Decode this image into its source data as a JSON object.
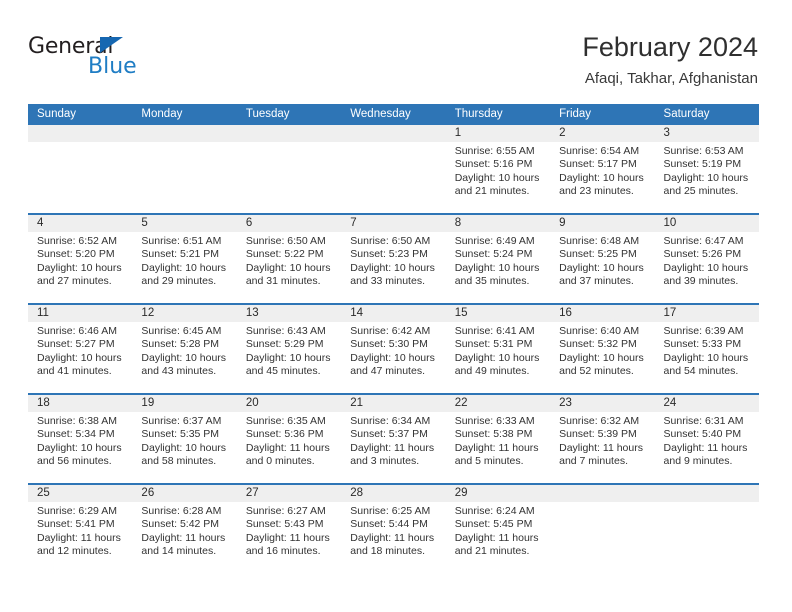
{
  "brand": {
    "name_part1": "General",
    "name_part2": "Blue",
    "triangle_icon": "triangle-icon",
    "accent_color": "#1f7dc4"
  },
  "header": {
    "title": "February 2024",
    "subtitle": "Afaqi, Takhar, Afghanistan"
  },
  "theme": {
    "header_blue": "#2e75b6",
    "daynum_gray": "#efefef",
    "text": "#333333"
  },
  "calendar": {
    "weekday_headers": [
      "Sunday",
      "Monday",
      "Tuesday",
      "Wednesday",
      "Thursday",
      "Friday",
      "Saturday"
    ],
    "weeks": [
      [
        {
          "day": "",
          "lines": []
        },
        {
          "day": "",
          "lines": []
        },
        {
          "day": "",
          "lines": []
        },
        {
          "day": "",
          "lines": []
        },
        {
          "day": "1",
          "lines": [
            "Sunrise: 6:55 AM",
            "Sunset: 5:16 PM",
            "Daylight: 10 hours",
            "and 21 minutes."
          ]
        },
        {
          "day": "2",
          "lines": [
            "Sunrise: 6:54 AM",
            "Sunset: 5:17 PM",
            "Daylight: 10 hours",
            "and 23 minutes."
          ]
        },
        {
          "day": "3",
          "lines": [
            "Sunrise: 6:53 AM",
            "Sunset: 5:19 PM",
            "Daylight: 10 hours",
            "and 25 minutes."
          ]
        }
      ],
      [
        {
          "day": "4",
          "lines": [
            "Sunrise: 6:52 AM",
            "Sunset: 5:20 PM",
            "Daylight: 10 hours",
            "and 27 minutes."
          ]
        },
        {
          "day": "5",
          "lines": [
            "Sunrise: 6:51 AM",
            "Sunset: 5:21 PM",
            "Daylight: 10 hours",
            "and 29 minutes."
          ]
        },
        {
          "day": "6",
          "lines": [
            "Sunrise: 6:50 AM",
            "Sunset: 5:22 PM",
            "Daylight: 10 hours",
            "and 31 minutes."
          ]
        },
        {
          "day": "7",
          "lines": [
            "Sunrise: 6:50 AM",
            "Sunset: 5:23 PM",
            "Daylight: 10 hours",
            "and 33 minutes."
          ]
        },
        {
          "day": "8",
          "lines": [
            "Sunrise: 6:49 AM",
            "Sunset: 5:24 PM",
            "Daylight: 10 hours",
            "and 35 minutes."
          ]
        },
        {
          "day": "9",
          "lines": [
            "Sunrise: 6:48 AM",
            "Sunset: 5:25 PM",
            "Daylight: 10 hours",
            "and 37 minutes."
          ]
        },
        {
          "day": "10",
          "lines": [
            "Sunrise: 6:47 AM",
            "Sunset: 5:26 PM",
            "Daylight: 10 hours",
            "and 39 minutes."
          ]
        }
      ],
      [
        {
          "day": "11",
          "lines": [
            "Sunrise: 6:46 AM",
            "Sunset: 5:27 PM",
            "Daylight: 10 hours",
            "and 41 minutes."
          ]
        },
        {
          "day": "12",
          "lines": [
            "Sunrise: 6:45 AM",
            "Sunset: 5:28 PM",
            "Daylight: 10 hours",
            "and 43 minutes."
          ]
        },
        {
          "day": "13",
          "lines": [
            "Sunrise: 6:43 AM",
            "Sunset: 5:29 PM",
            "Daylight: 10 hours",
            "and 45 minutes."
          ]
        },
        {
          "day": "14",
          "lines": [
            "Sunrise: 6:42 AM",
            "Sunset: 5:30 PM",
            "Daylight: 10 hours",
            "and 47 minutes."
          ]
        },
        {
          "day": "15",
          "lines": [
            "Sunrise: 6:41 AM",
            "Sunset: 5:31 PM",
            "Daylight: 10 hours",
            "and 49 minutes."
          ]
        },
        {
          "day": "16",
          "lines": [
            "Sunrise: 6:40 AM",
            "Sunset: 5:32 PM",
            "Daylight: 10 hours",
            "and 52 minutes."
          ]
        },
        {
          "day": "17",
          "lines": [
            "Sunrise: 6:39 AM",
            "Sunset: 5:33 PM",
            "Daylight: 10 hours",
            "and 54 minutes."
          ]
        }
      ],
      [
        {
          "day": "18",
          "lines": [
            "Sunrise: 6:38 AM",
            "Sunset: 5:34 PM",
            "Daylight: 10 hours",
            "and 56 minutes."
          ]
        },
        {
          "day": "19",
          "lines": [
            "Sunrise: 6:37 AM",
            "Sunset: 5:35 PM",
            "Daylight: 10 hours",
            "and 58 minutes."
          ]
        },
        {
          "day": "20",
          "lines": [
            "Sunrise: 6:35 AM",
            "Sunset: 5:36 PM",
            "Daylight: 11 hours",
            "and 0 minutes."
          ]
        },
        {
          "day": "21",
          "lines": [
            "Sunrise: 6:34 AM",
            "Sunset: 5:37 PM",
            "Daylight: 11 hours",
            "and 3 minutes."
          ]
        },
        {
          "day": "22",
          "lines": [
            "Sunrise: 6:33 AM",
            "Sunset: 5:38 PM",
            "Daylight: 11 hours",
            "and 5 minutes."
          ]
        },
        {
          "day": "23",
          "lines": [
            "Sunrise: 6:32 AM",
            "Sunset: 5:39 PM",
            "Daylight: 11 hours",
            "and 7 minutes."
          ]
        },
        {
          "day": "24",
          "lines": [
            "Sunrise: 6:31 AM",
            "Sunset: 5:40 PM",
            "Daylight: 11 hours",
            "and 9 minutes."
          ]
        }
      ],
      [
        {
          "day": "25",
          "lines": [
            "Sunrise: 6:29 AM",
            "Sunset: 5:41 PM",
            "Daylight: 11 hours",
            "and 12 minutes."
          ]
        },
        {
          "day": "26",
          "lines": [
            "Sunrise: 6:28 AM",
            "Sunset: 5:42 PM",
            "Daylight: 11 hours",
            "and 14 minutes."
          ]
        },
        {
          "day": "27",
          "lines": [
            "Sunrise: 6:27 AM",
            "Sunset: 5:43 PM",
            "Daylight: 11 hours",
            "and 16 minutes."
          ]
        },
        {
          "day": "28",
          "lines": [
            "Sunrise: 6:25 AM",
            "Sunset: 5:44 PM",
            "Daylight: 11 hours",
            "and 18 minutes."
          ]
        },
        {
          "day": "29",
          "lines": [
            "Sunrise: 6:24 AM",
            "Sunset: 5:45 PM",
            "Daylight: 11 hours",
            "and 21 minutes."
          ]
        },
        {
          "day": "",
          "lines": []
        },
        {
          "day": "",
          "lines": []
        }
      ]
    ]
  }
}
